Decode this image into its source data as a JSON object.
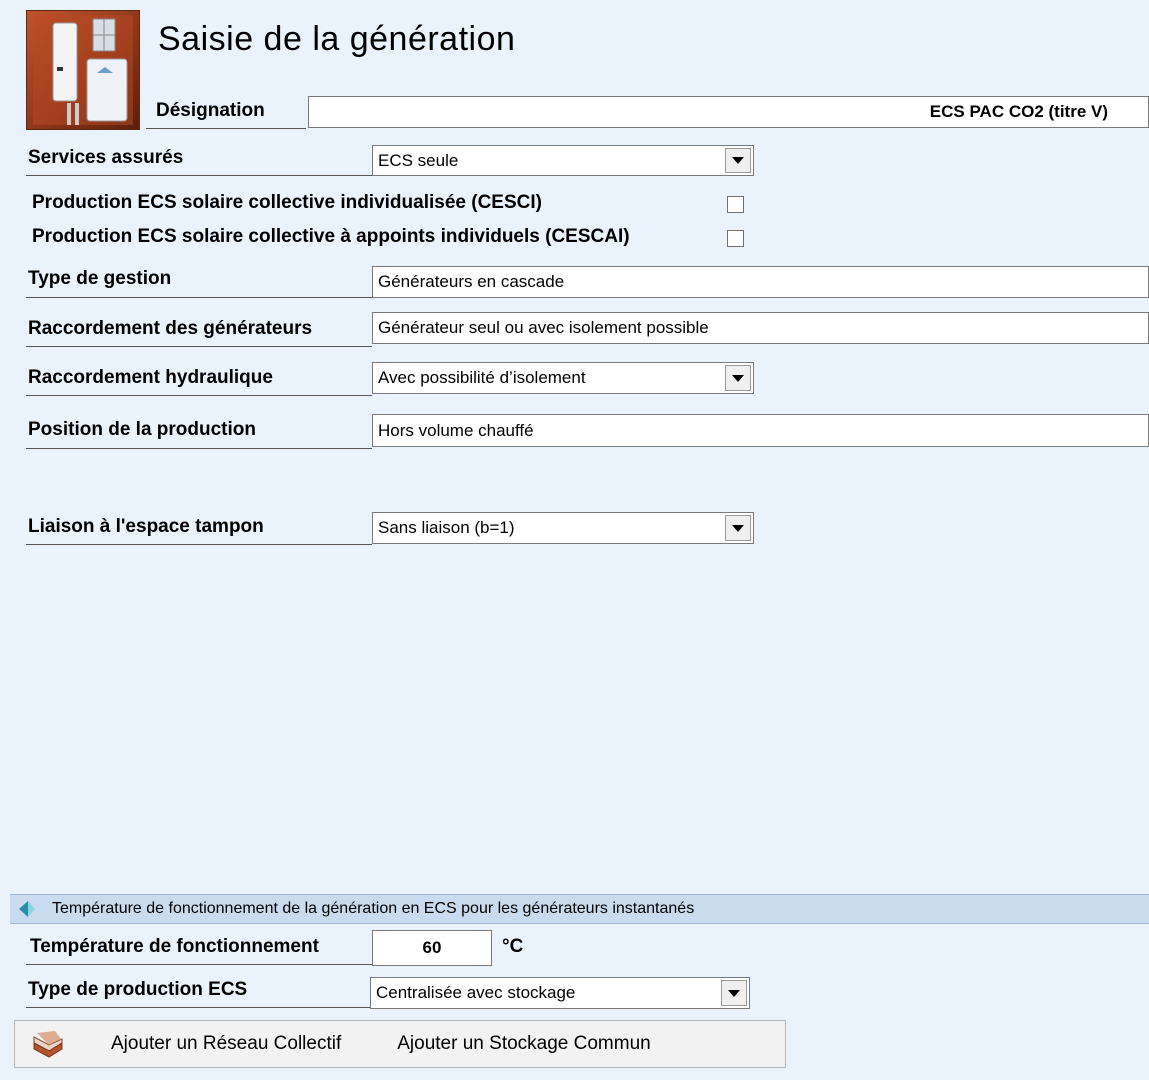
{
  "header": {
    "title": "Saisie de la génération",
    "designation_label": "Désignation",
    "designation_value": "ECS PAC CO2 (titre V)"
  },
  "form": {
    "services_label": "Services assurés",
    "services_value": "ECS seule",
    "cesci_label": "Production ECS solaire collective individualisée (CESCI)",
    "cesci_checked": false,
    "cescai_label": "Production ECS solaire collective à appoints individuels (CESCAI)",
    "cescai_checked": false,
    "gestion_label": "Type de gestion",
    "gestion_value": "Générateurs en cascade",
    "raccordement_gen_label": "Raccordement des générateurs",
    "raccordement_gen_value": "Générateur seul ou avec isolement possible",
    "raccordement_hyd_label": "Raccordement hydraulique",
    "raccordement_hyd_value": "Avec possibilité d’isolement",
    "position_label": "Position de la production",
    "position_value": "Hors volume chauffé",
    "liaison_label": "Liaison à l'espace tampon",
    "liaison_value": "Sans liaison (b=1)"
  },
  "section": {
    "title": "Température de fonctionnement de la génération en ECS pour les générateurs instantanés"
  },
  "temp": {
    "label": "Température de fonctionnement",
    "value": "60",
    "unit": "°C",
    "prod_label": "Type de production ECS",
    "prod_value": "Centralisée avec stockage"
  },
  "toolbar": {
    "add_reseau": "Ajouter un Réseau Collectif",
    "add_stockage": "Ajouter un Stockage Commun"
  },
  "colors": {
    "background": "#eaf2fb",
    "section_bar": "#c9dcef",
    "toolbar": "#f2f2f2"
  }
}
